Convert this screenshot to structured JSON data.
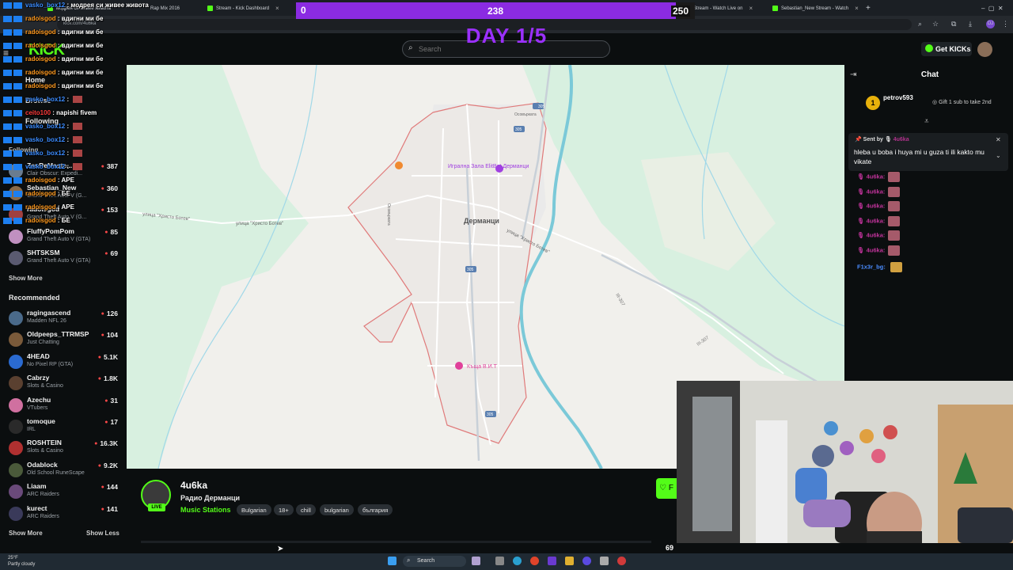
{
  "browser": {
    "tabs": [
      {
        "label": "модрея си живее живота"
      },
      {
        "label": "Rap Mix 2016"
      },
      {
        "label": "Stream - Kick Dashboard"
      },
      {
        "label": "Stream - Watch Live on"
      },
      {
        "label": "Sebastian_New Stream - Watch"
      }
    ],
    "url": "kick.com/4u6ka"
  },
  "goal": {
    "start": "0",
    "current": "238",
    "target": "250",
    "progress": 0.952,
    "day_label": "DAY 1/5"
  },
  "header": {
    "logo": "KICK",
    "search_placeholder": "Search",
    "get_kicks": "Get KICKs"
  },
  "sidebar": {
    "home": "Home",
    "browse": "Browse",
    "following_nav": "Following",
    "following_head": "Following",
    "following": [
      {
        "name": "ZenReMaste...",
        "category": "Clair Obscur: Expedi...",
        "viewers": "387",
        "color": "#6a7c8f"
      },
      {
        "name": "Sebastian_New",
        "category": "Grand Theft Auto V (G...",
        "viewers": "360",
        "color": "#8a6b4a"
      },
      {
        "name": "radoisgod",
        "category": "Grand Theft Auto V (G...",
        "viewers": "153",
        "color": "#a04040"
      },
      {
        "name": "FluffyPomPom",
        "category": "Grand Theft Auto V (GTA)",
        "viewers": "85",
        "color": "#c090c0"
      },
      {
        "name": "SHTSKSM",
        "category": "Grand Theft Auto V (GTA)",
        "viewers": "69",
        "color": "#5a5a70"
      }
    ],
    "show_more_1": "Show More",
    "recommended_head": "Recommended",
    "recommended": [
      {
        "name": "ragingascend",
        "category": "Madden NFL 26",
        "viewers": "126",
        "color": "#4a6a8a"
      },
      {
        "name": "Oldpeeps_TTRMSP",
        "category": "Just Chatting",
        "viewers": "104",
        "color": "#7a5a3a"
      },
      {
        "name": "4HEAD",
        "category": "No Pixel RP (GTA)",
        "viewers": "5.1K",
        "color": "#2a6ad0"
      },
      {
        "name": "Cabrzy",
        "category": "Slots & Casino",
        "viewers": "1.8K",
        "color": "#5a4030"
      },
      {
        "name": "Azechu",
        "category": "VTubers",
        "viewers": "31",
        "color": "#d070a0"
      },
      {
        "name": "tomoque",
        "category": "IRL",
        "viewers": "17",
        "color": "#2a2a2a"
      },
      {
        "name": "ROSHTEIN",
        "category": "Slots & Casino",
        "viewers": "16.3K",
        "color": "#b03030"
      },
      {
        "name": "Odablock",
        "category": "Old School RuneScape",
        "viewers": "9.2K",
        "color": "#4a5a3a"
      },
      {
        "name": "Liaam",
        "category": "ARC Raiders",
        "viewers": "144",
        "color": "#6a4a7a"
      },
      {
        "name": "kurect",
        "category": "ARC Raiders",
        "viewers": "141",
        "color": "#3a3a5a"
      }
    ],
    "show_more_2": "Show More",
    "show_less": "Show Less"
  },
  "overlay_chat": [
    {
      "user": "vasko_box12",
      "msg": "модрея си живее живота",
      "blue": true
    },
    {
      "user": "radoisgod",
      "msg": "вдигни ми бе"
    },
    {
      "user": "radoisgod",
      "msg": "вдигни ми бе"
    },
    {
      "user": "radoisgod",
      "msg": "вдигни ми бе"
    },
    {
      "user": "radoisgod",
      "msg": "вдигни ми бе"
    },
    {
      "user": "radoisgod",
      "msg": "вдигни ми бе"
    },
    {
      "user": "radoisgod",
      "msg": "вдигни ми бе"
    },
    {
      "user": "vasko_box12",
      "msg": "",
      "blue": true,
      "emote": true
    },
    {
      "user": "ceito100",
      "msg": "napishi fivem",
      "red": true
    },
    {
      "user": "vasko_box12",
      "msg": "",
      "blue": true,
      "emote": true
    },
    {
      "user": "vasko_box12",
      "msg": "",
      "blue": true,
      "emote": true
    },
    {
      "user": "vasko_box12",
      "msg": "",
      "blue": true,
      "emote": true
    },
    {
      "user": "vasko_box12",
      "msg": "",
      "blue": true,
      "emote": true
    },
    {
      "user": "radoisgod",
      "msg": "APE"
    },
    {
      "user": "radoisgod",
      "msg": "БЕ"
    },
    {
      "user": "radoisgod",
      "msg": "APE"
    },
    {
      "user": "radoisgod",
      "msg": "БЕ"
    }
  ],
  "map": {
    "town": "Дерманци",
    "poi_1": "Игрална Зала ElitBet Дерманци",
    "poi_2": "Къща В.И.Т",
    "street_1": "улица \"Христо Ботев\"",
    "street_2": "улица \"Христо Ботев\"",
    "street_3": "улица \"Христо Ботев\"",
    "road_1": "305",
    "road_2": "305",
    "road_3": "305",
    "road_4": "305",
    "road_5": "III-307",
    "road_6": "III-307",
    "road_7": "Осовърката",
    "road_8": "Осовърката"
  },
  "chat": {
    "title": "Chat",
    "pinned_rank": "1",
    "pinned_user": "petrov593",
    "pinned_gift": "Gift 1 sub to take 2nd",
    "sent_by_label": "Sent by",
    "sent_by_user": "4u6ka",
    "sent_msg": "hleba u boba i huya mi u guza ti ili kakto mu vikate",
    "lines": [
      {
        "user": "4u6ka"
      },
      {
        "user": "4u6ka"
      },
      {
        "user": "4u6ka"
      },
      {
        "user": "4u6ka"
      },
      {
        "user": "4u6ka"
      },
      {
        "user": "4u6ka"
      }
    ],
    "last_user": "F1x3r_bg"
  },
  "stream": {
    "streamer": "4u6ka",
    "title": "Радио Дерманци",
    "category": "Music Stations",
    "live": "LIVE",
    "tags": [
      "Bulgarian",
      "18+",
      "chill",
      "bulgarian",
      "българия"
    ],
    "viewer_count": "69",
    "follow": "F"
  },
  "taskbar": {
    "weather_temp": "25°F",
    "weather_desc": "Partly cloudy",
    "search": "Search"
  }
}
